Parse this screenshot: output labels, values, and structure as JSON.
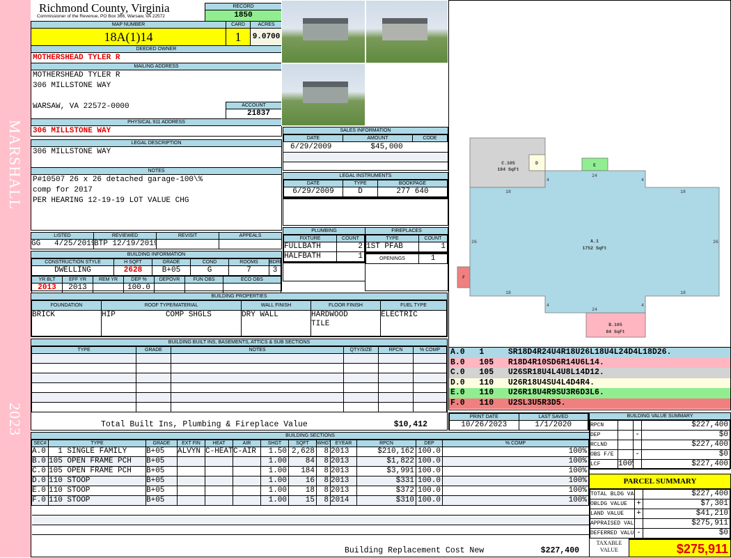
{
  "sidebar": {
    "name": "MARSHALL",
    "year": "2023"
  },
  "header": {
    "title": "Richmond County, Virginia",
    "subtitle": "Commissioner of the Revenue, PO Box 366, Warsaw, VA 22572",
    "record_label": "RECORD",
    "record": "1850"
  },
  "parcel": {
    "map_label": "MAP NUMBER",
    "map_number": "18A(1)14",
    "card_label": "CARD",
    "card": "1",
    "acres_label": "ACRES",
    "acres": "9.0700"
  },
  "owner": {
    "label": "DEEDED OWNER",
    "name": "MOTHERSHEAD TYLER R"
  },
  "mailing": {
    "label": "MAILING ADDRESS",
    "line1": "MOTHERSHEAD TYLER R",
    "line2": "306 MILLSTONE WAY",
    "line3": "WARSAW, VA 22572-0000",
    "account_label": "ACCOUNT",
    "account": "21837"
  },
  "physical": {
    "label": "PHYSICAL 911 ADDRESS",
    "address": "306 MILLSTONE WAY"
  },
  "legal": {
    "label": "LEGAL DESCRIPTION",
    "text": "306 MILLSTONE WAY"
  },
  "notes": {
    "label": "NOTES",
    "lines": [
      "P#10507 26 x 26 detached garage-100\\%",
      "comp for 2017",
      "PER HEARING 12-19-19 LOT VALUE CHG"
    ]
  },
  "review": {
    "headers": [
      "LISTED",
      "REVIEWED",
      "REVISIT",
      "APPEALS"
    ],
    "listed_by": "GG",
    "listed_date": "4/25/2019",
    "reviewed_by": "BTP",
    "reviewed_date": "12/19/2019"
  },
  "building_info": {
    "label": "BUILDING INFORMATION",
    "headers1": [
      "CONSTRUCTION STYLE",
      "H SQFT",
      "GRADE",
      "COND",
      "ROOMS",
      "BDRMS"
    ],
    "row1": [
      "DWELLING",
      "2628",
      "B+05",
      "G",
      "7",
      "3"
    ],
    "headers2": [
      "YR BLT",
      "EFF YR",
      "REM YR",
      "DEP %",
      "DEPOVR",
      "FUN OBS",
      "ECO OBS"
    ],
    "row2": [
      "2013",
      "2013",
      "",
      "100.0",
      "",
      "",
      ""
    ]
  },
  "building_props": {
    "label": "BUILDING PROPERTIES",
    "headers": [
      "FOUNDATION",
      "ROOF TYPE/MATERIAL",
      "WALL FINISH",
      "FLOOR FINISH",
      "FUEL TYPE"
    ],
    "foundation": "BRICK",
    "roof_type": "HIP",
    "roof_material": "COMP SHGLS",
    "wall": "DRY WALL",
    "floor1": "HARDWOOD",
    "floor2": "TILE",
    "fuel": "ELECTRIC"
  },
  "builtins": {
    "label": "BUILDING BUILT INS, BASEMENTS, ATTICS & SUB SECTIONS",
    "headers": [
      "TYPE",
      "GRADE",
      "NOTES",
      "QTY/SIZE",
      "RPCN",
      "% COMP"
    ],
    "total_label": "Total Built Ins, Plumbing & Fireplace Value",
    "total": "$10,412"
  },
  "sales": {
    "label": "SALES INFORMATION",
    "headers": [
      "DATE",
      "AMOUNT",
      "CODE"
    ],
    "date": "6/29/2009",
    "amount": "$45,000"
  },
  "instruments": {
    "label": "LEGAL INSTRUMENTS",
    "headers": [
      "DATE",
      "TYPE",
      "BOOKPAGE"
    ],
    "date": "6/29/2009",
    "type": "D",
    "bookpage": "277 640"
  },
  "plumbing": {
    "label": "PLUMBING",
    "headers": [
      "FIXTURE",
      "COUNT"
    ],
    "rows": [
      [
        "FULLBATH",
        "2"
      ],
      [
        "HALFBATH",
        "1"
      ]
    ]
  },
  "fireplaces": {
    "label": "FIREPLACES",
    "headers": [
      "TYPE",
      "COUNT"
    ],
    "type": "1ST PFAB",
    "count": "1",
    "openings_label": "OPENINGS",
    "openings": "1"
  },
  "sketch": {
    "a_label": "A.1",
    "a_area": "1752 SqFt",
    "b_label": "B.105",
    "b_area": "84 SqFt",
    "c_label": "C.105",
    "c_area": "184 SqFt",
    "d_label": "D",
    "e_label": "E",
    "f_label": "F",
    "dims": {
      "top": "24",
      "bottom": "24",
      "left": "26",
      "right": "26",
      "tl": "18",
      "tr": "18",
      "bl": "18",
      "br": "18",
      "step": "4"
    },
    "codes": [
      {
        "text": "A.0   1     SR18D4R24U4R18U26L18U4L24D4L18D26.",
        "color": "#add8e6"
      },
      {
        "text": "B.0   105   R18D4R10SD6R14U6L14.",
        "color": "#ffb6c1"
      },
      {
        "text": "C.0   105   U26SR18U4L4U8L14D12.",
        "color": "#d3d3d3"
      },
      {
        "text": "D.0   110   U26R18U4SU4L4D4R4.",
        "color": "#fffde0"
      },
      {
        "text": "E.0   110   U26R18U4R9SU3R6D3L6.",
        "color": "#90ee90"
      },
      {
        "text": "F.0   110   U2SL3U5R3D5.",
        "color": "#f08080"
      }
    ]
  },
  "dates": {
    "print_label": "PRINT DATE",
    "print": "10/26/2023",
    "saved_label": "LAST SAVED",
    "saved": "1/1/2020"
  },
  "sections": {
    "label": "BUILDING SECTIONS",
    "headers": [
      "SEC#",
      "TYPE",
      "GRADE",
      "EXT FIN",
      "HEAT",
      "AIR",
      "SHGT",
      "SQFT",
      "WHGT",
      "EYEAR",
      "RPCN",
      "DEP",
      "% COMP"
    ],
    "rows": [
      [
        "A.0",
        "  1 SINGLE FAMILY",
        "B+05",
        "ALVYN",
        "C-HEAT",
        "C-AIR",
        "1.50",
        "2,628",
        "8",
        "2013",
        "$210,162",
        "100.0",
        "100%"
      ],
      [
        "B.0",
        "105 OPEN FRAME PCH",
        "B+05",
        "",
        "",
        "",
        "1.00",
        "84",
        "8",
        "2013",
        "$1,822",
        "100.0",
        "100%"
      ],
      [
        "C.0",
        "105 OPEN FRAME PCH",
        "B+05",
        "",
        "",
        "",
        "1.00",
        "184",
        "8",
        "2013",
        "$3,991",
        "100.0",
        "100%"
      ],
      [
        "D.0",
        "110 STOOP",
        "B+05",
        "",
        "",
        "",
        "1.00",
        "16",
        "8",
        "2013",
        "$331",
        "100.0",
        "100%"
      ],
      [
        "E.0",
        "110 STOOP",
        "B+05",
        "",
        "",
        "",
        "1.00",
        "18",
        "8",
        "2013",
        "$372",
        "100.0",
        "100%"
      ],
      [
        "F.0",
        "110 STOOP",
        "B+05",
        "",
        "",
        "",
        "1.00",
        "15",
        "8",
        "2014",
        "$310",
        "100.0",
        "100%"
      ]
    ],
    "total_label": "Building Replacement Cost New",
    "total": "$227,400"
  },
  "value_summary": {
    "label": "BUILDING VALUE SUMMARY",
    "rows": [
      [
        "RPCN",
        "",
        "",
        "$227,400"
      ],
      [
        "DEP",
        "",
        "-",
        "$0"
      ],
      [
        "RCLND",
        "",
        "",
        "$227,400"
      ],
      [
        "OBS F/E",
        "",
        "-",
        "$0"
      ],
      [
        "LCF",
        "100%",
        "",
        "$227,400"
      ]
    ]
  },
  "parcel_summary": {
    "label": "PARCEL SUMMARY",
    "rows": [
      [
        "TOTAL BLDG VALUE",
        "",
        "$227,400"
      ],
      [
        "OBLDG VALUE",
        "+",
        "$7,301"
      ],
      [
        "LAND VALUE",
        "+",
        "$41,210"
      ],
      [
        "APPRAISED VALUE",
        "",
        "$275,911"
      ],
      [
        "DEFERRED VALUE",
        "-",
        "$0"
      ]
    ],
    "taxable_label": "TAXABLE VALUE",
    "taxable": "$275,911"
  },
  "colors": {
    "header": "#add8e6",
    "highlight": "#ffff00",
    "record": "#90ee90",
    "red": "#e00000",
    "sidebar": "#ffc0cb"
  }
}
